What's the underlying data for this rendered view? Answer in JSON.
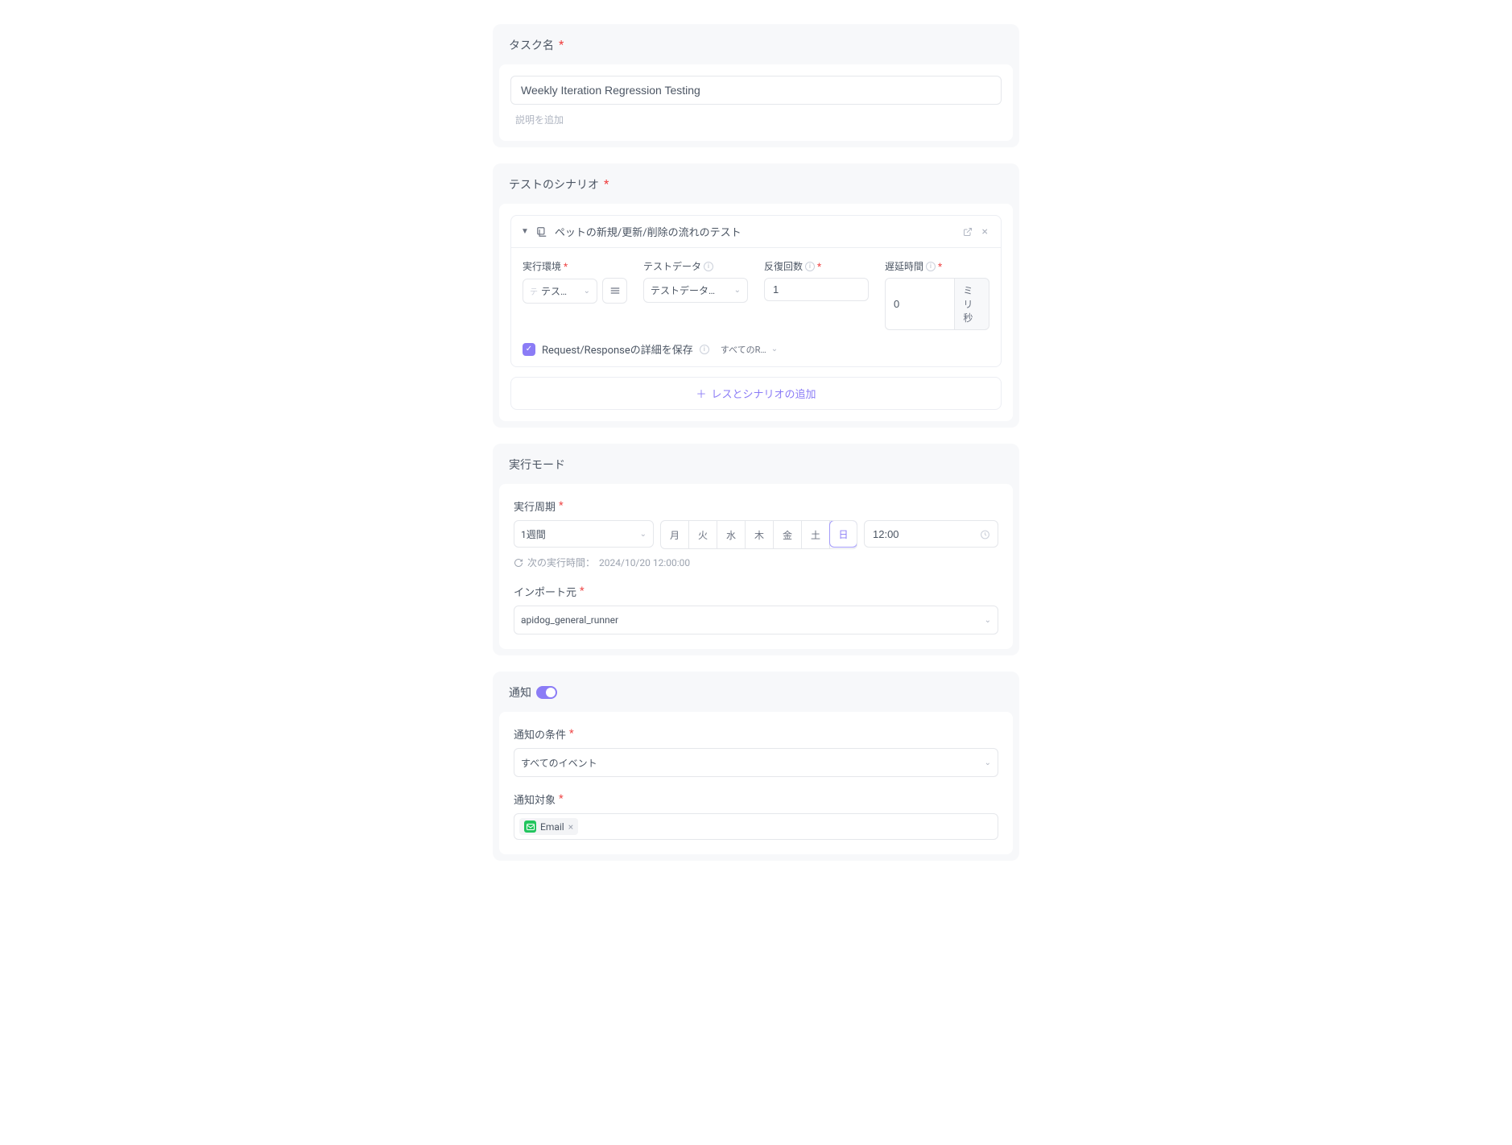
{
  "task_name": {
    "section_label": "タスク名",
    "value": "Weekly Iteration Regression Testing",
    "description_placeholder": "説明を追加"
  },
  "test_scenario": {
    "section_label": "テストのシナリオ",
    "item": {
      "title": "ペットの新規/更新/削除の流れのテスト",
      "env_label": "実行環境",
      "env_value": "テス…",
      "testdata_label": "テストデータ",
      "testdata_value": "テストデータ…",
      "iterations_label": "反復回数",
      "iterations_value": "1",
      "delay_label": "遅延時間",
      "delay_value": "0",
      "delay_unit": "ミリ秒",
      "save_detail_label": "Request/Responseの詳細を保存",
      "save_detail_scope": "すべてのR…"
    },
    "add_button": "レスとシナリオの追加"
  },
  "run_mode": {
    "section_label": "実行モード",
    "period_label": "実行周期",
    "period_value": "1週間",
    "days": [
      "月",
      "火",
      "水",
      "木",
      "金",
      "土",
      "日"
    ],
    "selected_day_index": 6,
    "time_value": "12:00",
    "next_run_label": "次の実行時間：",
    "next_run_value": "2024/10/20 12:00:00",
    "import_label": "インポート元",
    "import_value": "apidog_general_runner"
  },
  "notify": {
    "section_label": "通知",
    "enabled": true,
    "condition_label": "通知の条件",
    "condition_value": "すべてのイベント",
    "target_label": "通知対象",
    "target_chips": [
      "Email"
    ]
  }
}
